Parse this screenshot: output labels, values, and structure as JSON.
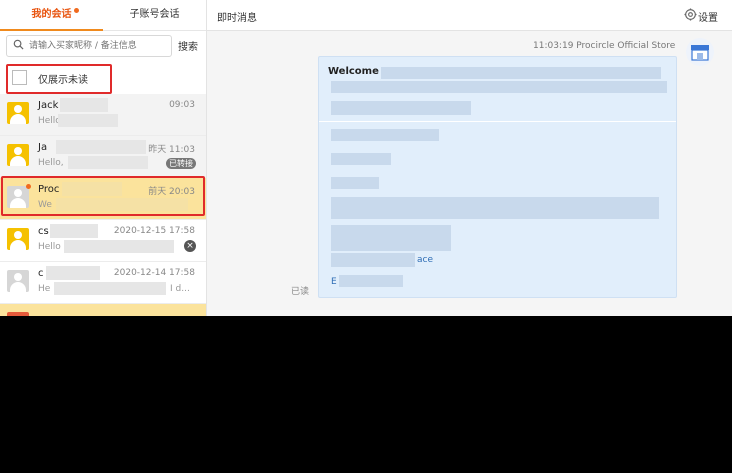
{
  "tabs": {
    "my_sessions": "我的会话",
    "sub_sessions": "子账号会话"
  },
  "search": {
    "placeholder": "请输入买家昵称 / 备注信息",
    "button": "搜索"
  },
  "filter": {
    "unread_only": "仅展示未读"
  },
  "conversations": [
    {
      "name": "Jack",
      "time": "09:03",
      "preview": "Hello",
      "avatar": "yellow-user-icon"
    },
    {
      "name": "Ja",
      "time": "昨天 11:03",
      "preview": "Hello,",
      "badge": "已转接",
      "avatar": "yellow-user-icon"
    },
    {
      "name": "Proc",
      "time": "前天 20:03",
      "preview": "We",
      "avatar": "grey-user-icon",
      "unread": true
    },
    {
      "name": "cs",
      "time": "2020-12-15 17:58",
      "preview": "Hello",
      "avatar": "yellow-user-icon",
      "close": "×"
    },
    {
      "name": "c",
      "time": "2020-12-14 17:58",
      "preview": "He",
      "preview_tail": "I d...",
      "avatar": "grey-user-icon"
    }
  ],
  "chat": {
    "header": "即时消息",
    "settings": "设置",
    "message_meta": "11:03:19  Procircle Official Store",
    "welcome": "Welcome",
    "link_fragment": "ace",
    "e_fragment": "E",
    "read_status": "已读"
  },
  "colors": {
    "accent": "#e8540f",
    "highlight_red": "#e02a2a",
    "selected_bg": "#fbe39c",
    "bubble_bg": "#e1eefb"
  }
}
